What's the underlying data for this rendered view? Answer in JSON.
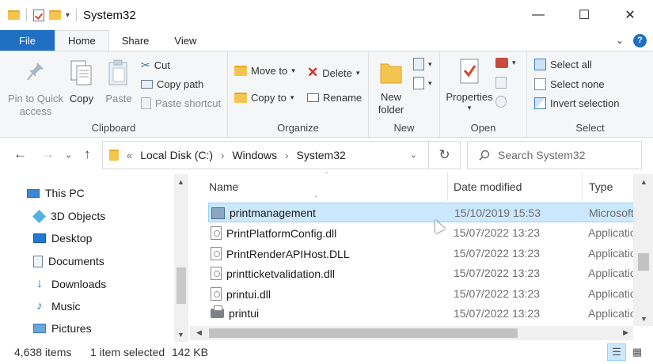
{
  "window": {
    "title": "System32",
    "controls": {
      "minimize": "—",
      "maximize": "☐",
      "close": "✕"
    }
  },
  "ribbon_tabs": [
    "File",
    "Home",
    "Share",
    "View"
  ],
  "ribbon": {
    "clipboard": {
      "label": "Clipboard",
      "pin": "Pin to Quick access",
      "copy": "Copy",
      "paste": "Paste",
      "cut": "Cut",
      "copy_path": "Copy path",
      "paste_shortcut": "Paste shortcut"
    },
    "organize": {
      "label": "Organize",
      "move_to": "Move to",
      "copy_to": "Copy to",
      "delete": "Delete",
      "rename": "Rename"
    },
    "new": {
      "label": "New",
      "new_folder": "New folder"
    },
    "open": {
      "label": "Open",
      "properties": "Properties"
    },
    "select": {
      "label": "Select",
      "select_all": "Select all",
      "select_none": "Select none",
      "invert": "Invert selection"
    }
  },
  "address": {
    "crumbs": [
      "Local Disk (C:)",
      "Windows",
      "System32"
    ],
    "overflow": "«"
  },
  "search": {
    "placeholder": "Search System32"
  },
  "nav_pane": [
    {
      "label": "This PC",
      "icon": "pc-icon"
    },
    {
      "label": "3D Objects",
      "icon": "cube-icon"
    },
    {
      "label": "Desktop",
      "icon": "desktop-icon"
    },
    {
      "label": "Documents",
      "icon": "documents-icon"
    },
    {
      "label": "Downloads",
      "icon": "downloads-icon"
    },
    {
      "label": "Music",
      "icon": "music-icon"
    },
    {
      "label": "Pictures",
      "icon": "pictures-icon"
    }
  ],
  "columns": {
    "name": "Name",
    "date": "Date modified",
    "type": "Type"
  },
  "files": [
    {
      "name": "printmanagement",
      "date": "15/10/2019 15:53",
      "type": "Microsoft Common Console Document",
      "icon": "mmc-icon",
      "selected": true
    },
    {
      "name": "PrintPlatformConfig.dll",
      "date": "15/07/2022 13:23",
      "type": "Application extension",
      "icon": "dll-icon"
    },
    {
      "name": "PrintRenderAPIHost.DLL",
      "date": "15/07/2022 13:23",
      "type": "Application extension",
      "icon": "dll-icon"
    },
    {
      "name": "printticketvalidation.dll",
      "date": "15/07/2022 13:23",
      "type": "Application extension",
      "icon": "dll-icon"
    },
    {
      "name": "printui.dll",
      "date": "15/07/2022 13:23",
      "type": "Application extension",
      "icon": "dll-icon"
    },
    {
      "name": "printui",
      "date": "15/07/2022 13:23",
      "type": "Application",
      "icon": "printer-icon"
    }
  ],
  "status": {
    "items": "4,638 items",
    "selected": "1 item selected",
    "size": "142 KB"
  },
  "colors": {
    "accent": "#1f6fc5",
    "selection": "#cce8ff",
    "folder": "#f3c44e"
  }
}
